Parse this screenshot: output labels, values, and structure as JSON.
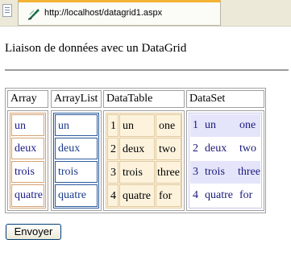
{
  "browser": {
    "tab_title": "http://localhost/datagrid1.aspx"
  },
  "page": {
    "title": "Liaison de données avec un DataGrid",
    "submit_label": "Envoyer"
  },
  "headers": [
    "Array",
    "ArrayList",
    "DataTable",
    "DataSet"
  ],
  "array_items": [
    "un",
    "deux",
    "trois",
    "quatre"
  ],
  "arraylist_items": [
    "un",
    "deux",
    "trois",
    "quatre"
  ],
  "datatable_rows": [
    {
      "id": "1",
      "fr": "un",
      "en": "one"
    },
    {
      "id": "2",
      "fr": "deux",
      "en": "two"
    },
    {
      "id": "3",
      "fr": "trois",
      "en": "three"
    },
    {
      "id": "4",
      "fr": "quatre",
      "en": "for"
    }
  ],
  "dataset_rows": [
    {
      "id": "1",
      "fr": "un",
      "en": "one"
    },
    {
      "id": "2",
      "fr": "deux",
      "en": "two"
    },
    {
      "id": "3",
      "fr": "trois",
      "en": "three"
    },
    {
      "id": "4",
      "fr": "quatre",
      "en": "for"
    }
  ],
  "colors": {
    "array_text": "#1a1a8c",
    "array_border": "#d4a373",
    "arraylist_text": "#1a3a8c",
    "arraylist_border": "#2a5a9a",
    "datatable_bg": "#fdf3dd",
    "datatable_border": "#e0c9a0",
    "dataset_bg_alt": "#e4e4fb",
    "dataset_text": "#1a1a7a"
  }
}
